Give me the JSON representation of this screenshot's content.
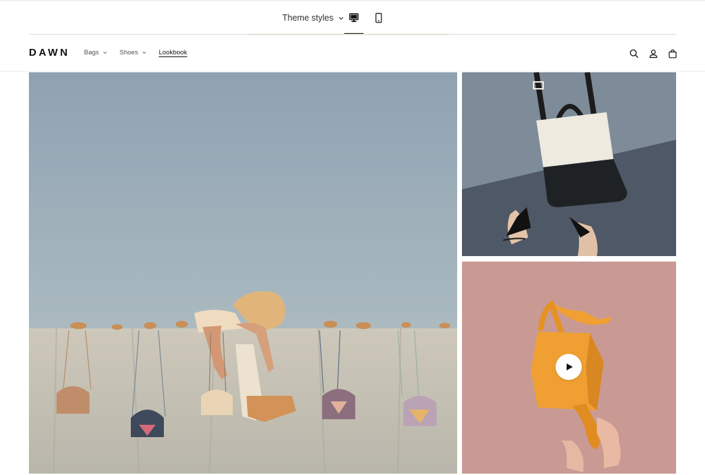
{
  "editor": {
    "theme_styles_label": "Theme styles",
    "icons": {
      "dropdown": "chevron-down-icon",
      "desktop_view": "desktop-icon",
      "mobile_view": "mobile-icon"
    },
    "selected_view": "desktop"
  },
  "header": {
    "logo": "DAWN",
    "nav": [
      {
        "label": "Bags",
        "has_dropdown": true
      },
      {
        "label": "Shoes",
        "has_dropdown": true
      },
      {
        "label": "Lookbook",
        "has_dropdown": false,
        "active": true
      }
    ],
    "icons": [
      "search-icon",
      "account-icon",
      "cart-icon"
    ]
  },
  "collage": {
    "tiles": [
      {
        "kind": "image",
        "subject": "person draped over a wall with handbags hanging from it"
      },
      {
        "kind": "image",
        "subject": "black and white tote bag with pointed black shoes"
      },
      {
        "kind": "video",
        "subject": "orange handbag on pink floor",
        "play_icon": "play-icon"
      }
    ]
  },
  "colors": {
    "text": "#121212",
    "accent_underline": "#121212",
    "sky_top": "#8ea2b2",
    "sky_bottom": "#c6d0d2",
    "wall": "#c7c3b6",
    "orange_bag": "#f0a032",
    "pink_floor": "#c99a94"
  }
}
